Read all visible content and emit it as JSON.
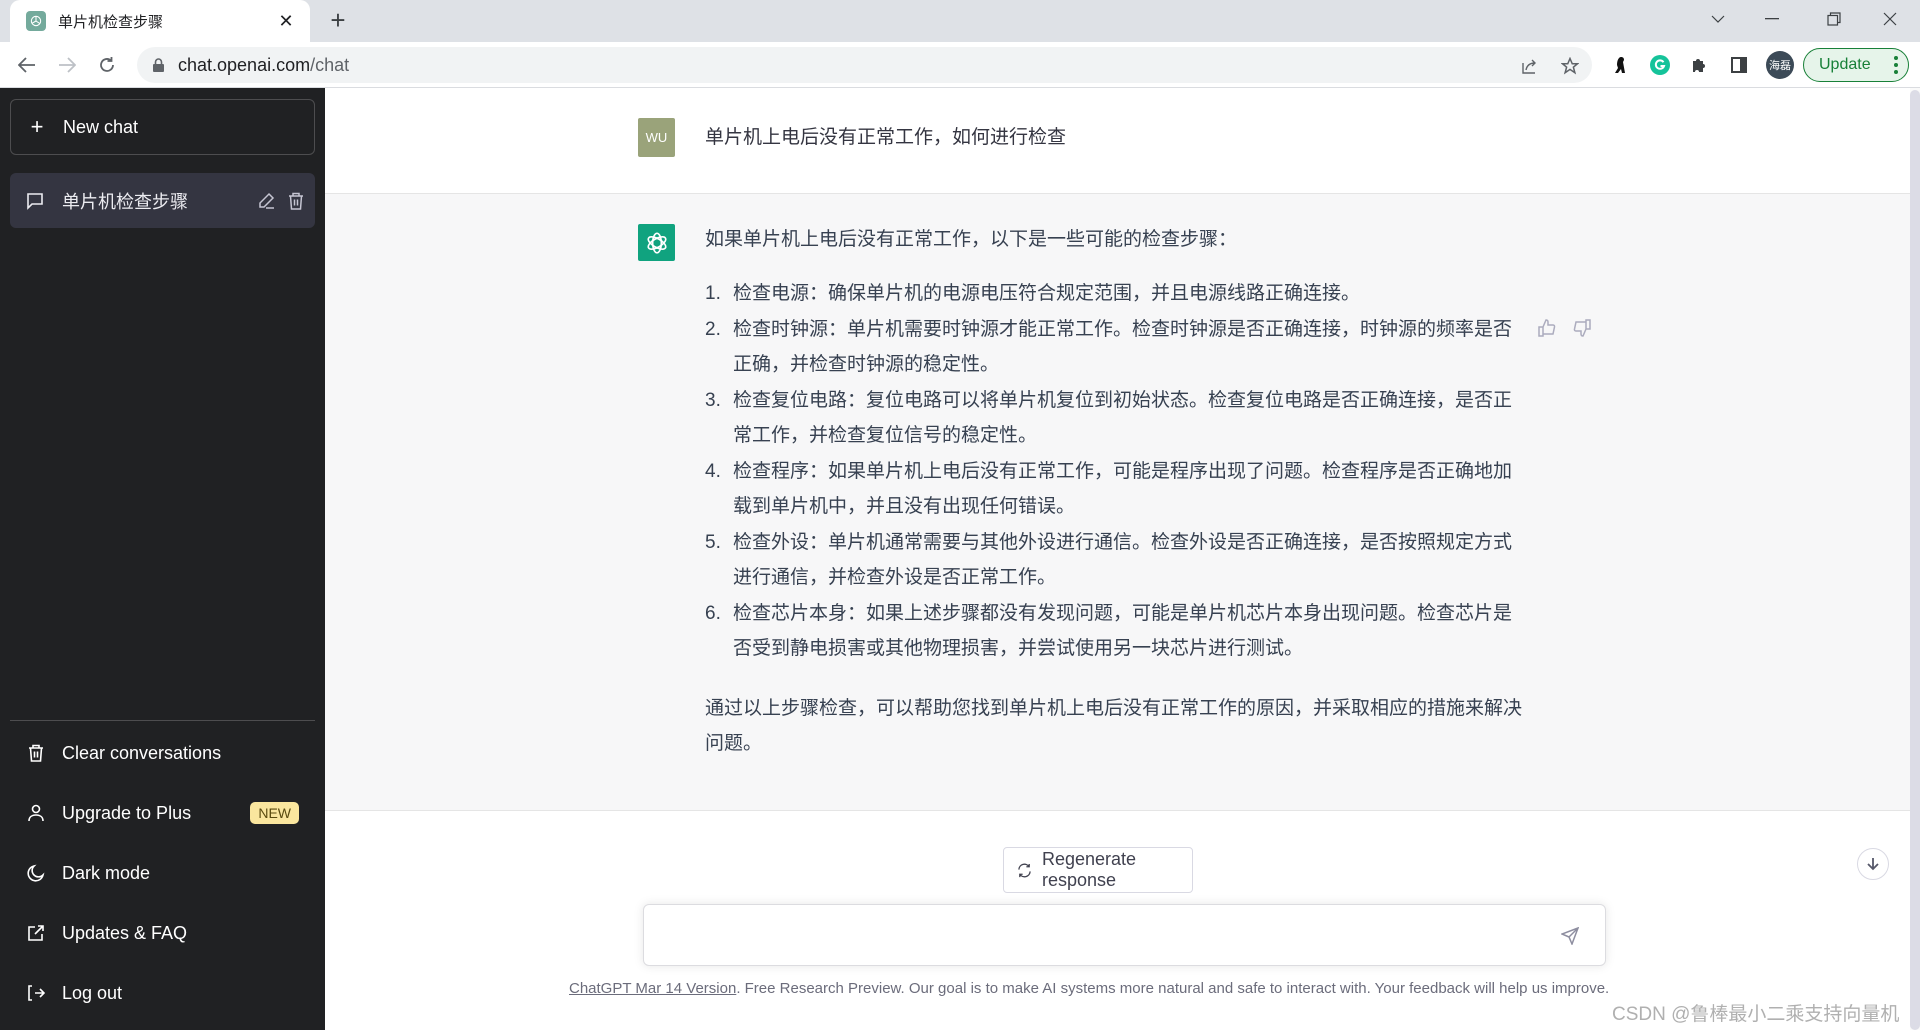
{
  "browser": {
    "tab": {
      "title": "单片机检查步骤",
      "favicon": "openai-logo-icon"
    },
    "new_tab_label": "+",
    "address": {
      "host": "chat.openai.com",
      "path": "/chat"
    },
    "profile_avatar_text": "海磊",
    "update_label": "Update",
    "extensions": [
      "bird-extension-icon",
      "grammarly-icon",
      "puzzle-icon",
      "side-panel-icon"
    ],
    "colors": {
      "update_green": "#188038",
      "update_bg": "#e6f4ea"
    }
  },
  "sidebar": {
    "new_chat_label": "New chat",
    "conversations": [
      {
        "title": "单片机检查步骤",
        "active": true
      }
    ],
    "menu": [
      {
        "label": "Clear conversations",
        "icon": "trash-icon"
      },
      {
        "label": "Upgrade to Plus",
        "icon": "user-icon",
        "badge": "NEW"
      },
      {
        "label": "Dark mode",
        "icon": "moon-icon"
      },
      {
        "label": "Updates & FAQ",
        "icon": "external-link-icon"
      },
      {
        "label": "Log out",
        "icon": "logout-icon"
      }
    ],
    "colors": {
      "background": "#202123",
      "active_item": "#343541",
      "badge": "#fae69e"
    }
  },
  "chat": {
    "user": {
      "avatar_initials": "WU",
      "message": "单片机上电后没有正常工作，如何进行检查"
    },
    "assistant": {
      "intro": "如果单片机上电后没有正常工作，以下是一些可能的检查步骤：",
      "steps": [
        {
          "num": "1.",
          "text": "检查电源：确保单片机的电源电压符合规定范围，并且电源线路正确连接。"
        },
        {
          "num": "2.",
          "text": "检查时钟源：单片机需要时钟源才能正常工作。检查时钟源是否正确连接，时钟源的频率是否正确，并检查时钟源的稳定性。"
        },
        {
          "num": "3.",
          "text": "检查复位电路：复位电路可以将单片机复位到初始状态。检查复位电路是否正确连接，是否正常工作，并检查复位信号的稳定性。"
        },
        {
          "num": "4.",
          "text": "检查程序：如果单片机上电后没有正常工作，可能是程序出现了问题。检查程序是否正确地加载到单片机中，并且没有出现任何错误。"
        },
        {
          "num": "5.",
          "text": "检查外设：单片机通常需要与其他外设进行通信。检查外设是否正确连接，是否按照规定方式进行通信，并检查外设是否正常工作。"
        },
        {
          "num": "6.",
          "text": "检查芯片本身：如果上述步骤都没有发现问题，可能是单片机芯片本身出现问题。检查芯片是否受到静电损害或其他物理损害，并尝试使用另一块芯片进行测试。"
        }
      ],
      "outro": "通过以上步骤检查，可以帮助您找到单片机上电后没有正常工作的原因，并采取相应的措施来解决问题。"
    },
    "colors": {
      "gpt_avatar": "#10a37f",
      "user_avatar": "#9aa37a",
      "assistant_bg": "#f7f7f8"
    }
  },
  "composer": {
    "regenerate_label": "Regenerate response",
    "input_value": "",
    "input_placeholder": ""
  },
  "footer": {
    "version_link": "ChatGPT Mar 14 Version",
    "text": ". Free Research Preview. Our goal is to make AI systems more natural and safe to interact with. Your feedback will help us improve."
  },
  "watermark": "CSDN @鲁棒最小二乘支持向量机"
}
